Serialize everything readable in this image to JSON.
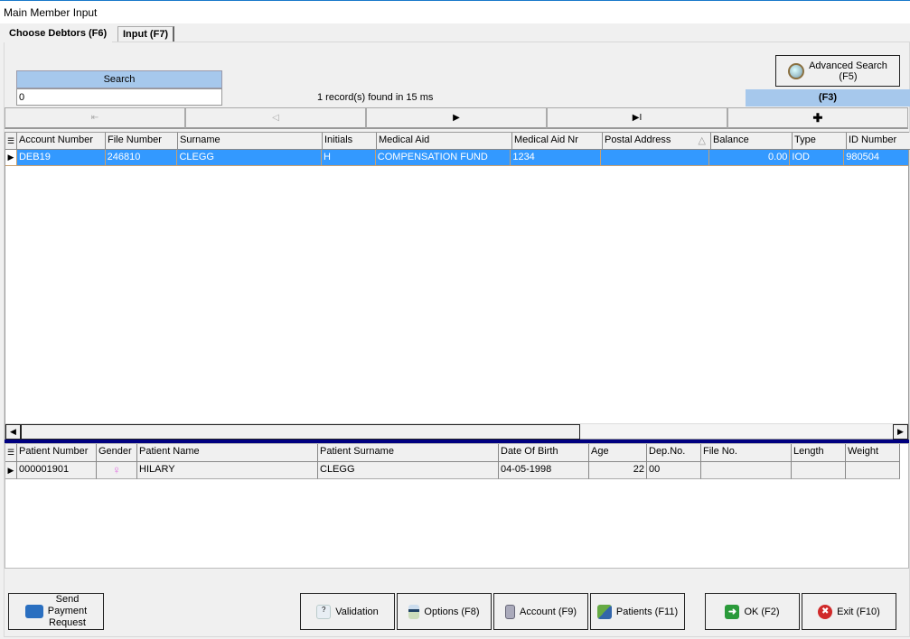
{
  "window": {
    "title": "Main Member Input"
  },
  "tabs": [
    {
      "label": "Choose Debtors (F6)",
      "active": true
    },
    {
      "label": "Input (F7)",
      "active": false
    }
  ],
  "search": {
    "label": "Search",
    "value": "0",
    "status": "1 record(s) found in 15 ms"
  },
  "advanced_search": {
    "line1": "Advanced Search",
    "line2": "(F5)"
  },
  "f3_label": "(F3)",
  "nav": {
    "first": "⇤",
    "prev": "◁",
    "next": "▶",
    "last": "▶I",
    "add": "✚"
  },
  "debtors": {
    "columns": [
      "Account Number",
      "File Number",
      "Surname",
      "Initials",
      "Medical Aid",
      "Medical Aid Nr",
      "Postal Address",
      "Balance",
      "Type",
      "ID Number"
    ],
    "sort_indicator": "△",
    "rows": [
      [
        "DEB19",
        "246810",
        "CLEGG",
        "H",
        "COMPENSATION FUND",
        "1234",
        "",
        "0.00",
        "IOD",
        "980504"
      ]
    ]
  },
  "patients": {
    "columns": [
      "Patient Number",
      "Gender",
      "Patient Name",
      "Patient Surname",
      "Date Of Birth",
      "Age",
      "Dep.No.",
      "File No.",
      "Length",
      "Weight"
    ],
    "rows": [
      [
        "000001901",
        "♀",
        "HILARY",
        "CLEGG",
        "04-05-1998",
        "22",
        "00",
        "",
        "",
        ""
      ]
    ]
  },
  "buttons": {
    "send_payment": [
      "Send",
      "Payment",
      "Request"
    ],
    "validation": "Validation",
    "options": "Options (F8)",
    "account": "Account (F9)",
    "patients": "Patients (F11)",
    "ok": "OK (F2)",
    "exit": "Exit (F10)"
  },
  "colors": {
    "selection": "#3399ff",
    "accent_bar": "#a6c8ec",
    "separator": "#000080"
  }
}
